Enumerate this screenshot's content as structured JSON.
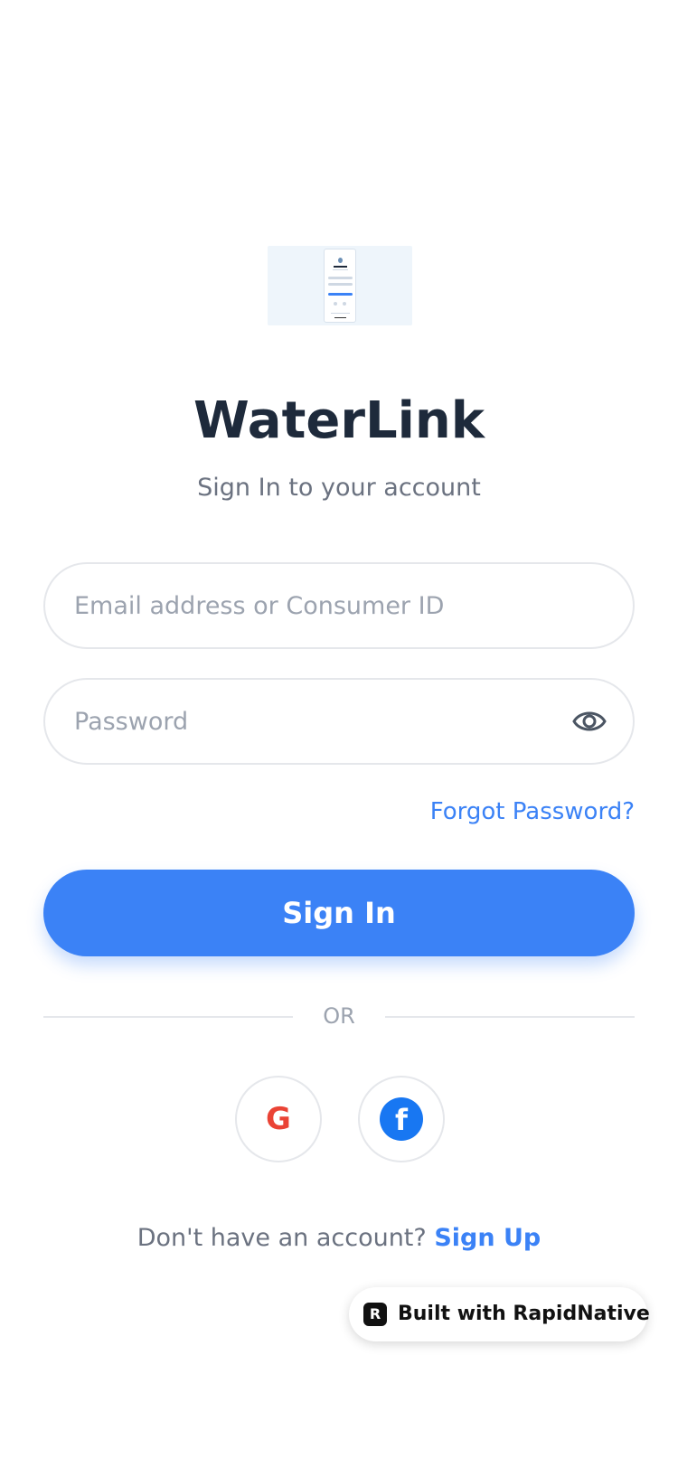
{
  "app": {
    "title": "WaterLink",
    "subtitle": "Sign In to your account"
  },
  "form": {
    "email_placeholder": "Email address or Consumer ID",
    "email_value": "",
    "password_placeholder": "Password",
    "password_value": "",
    "forgot_label": "Forgot Password?",
    "signin_label": "Sign In"
  },
  "divider": {
    "label": "OR"
  },
  "social": {
    "google_label": "G",
    "facebook_label": "f"
  },
  "signup": {
    "prompt": "Don't have an account?",
    "link_label": "Sign Up"
  },
  "badge": {
    "icon_letter": "R",
    "label": "Built with RapidNative"
  },
  "icons": {
    "logo": "app-logo-image",
    "password_toggle": "eye-icon",
    "google": "google-icon",
    "facebook": "facebook-icon",
    "badge": "rapidnative-icon"
  },
  "colors": {
    "accent": "#3b82f6",
    "title": "#1e2a3b",
    "muted": "#6b7280",
    "placeholder": "#9ca3af",
    "border": "#e5e7eb",
    "google_red": "#ea4335",
    "facebook_blue": "#1877f2"
  }
}
